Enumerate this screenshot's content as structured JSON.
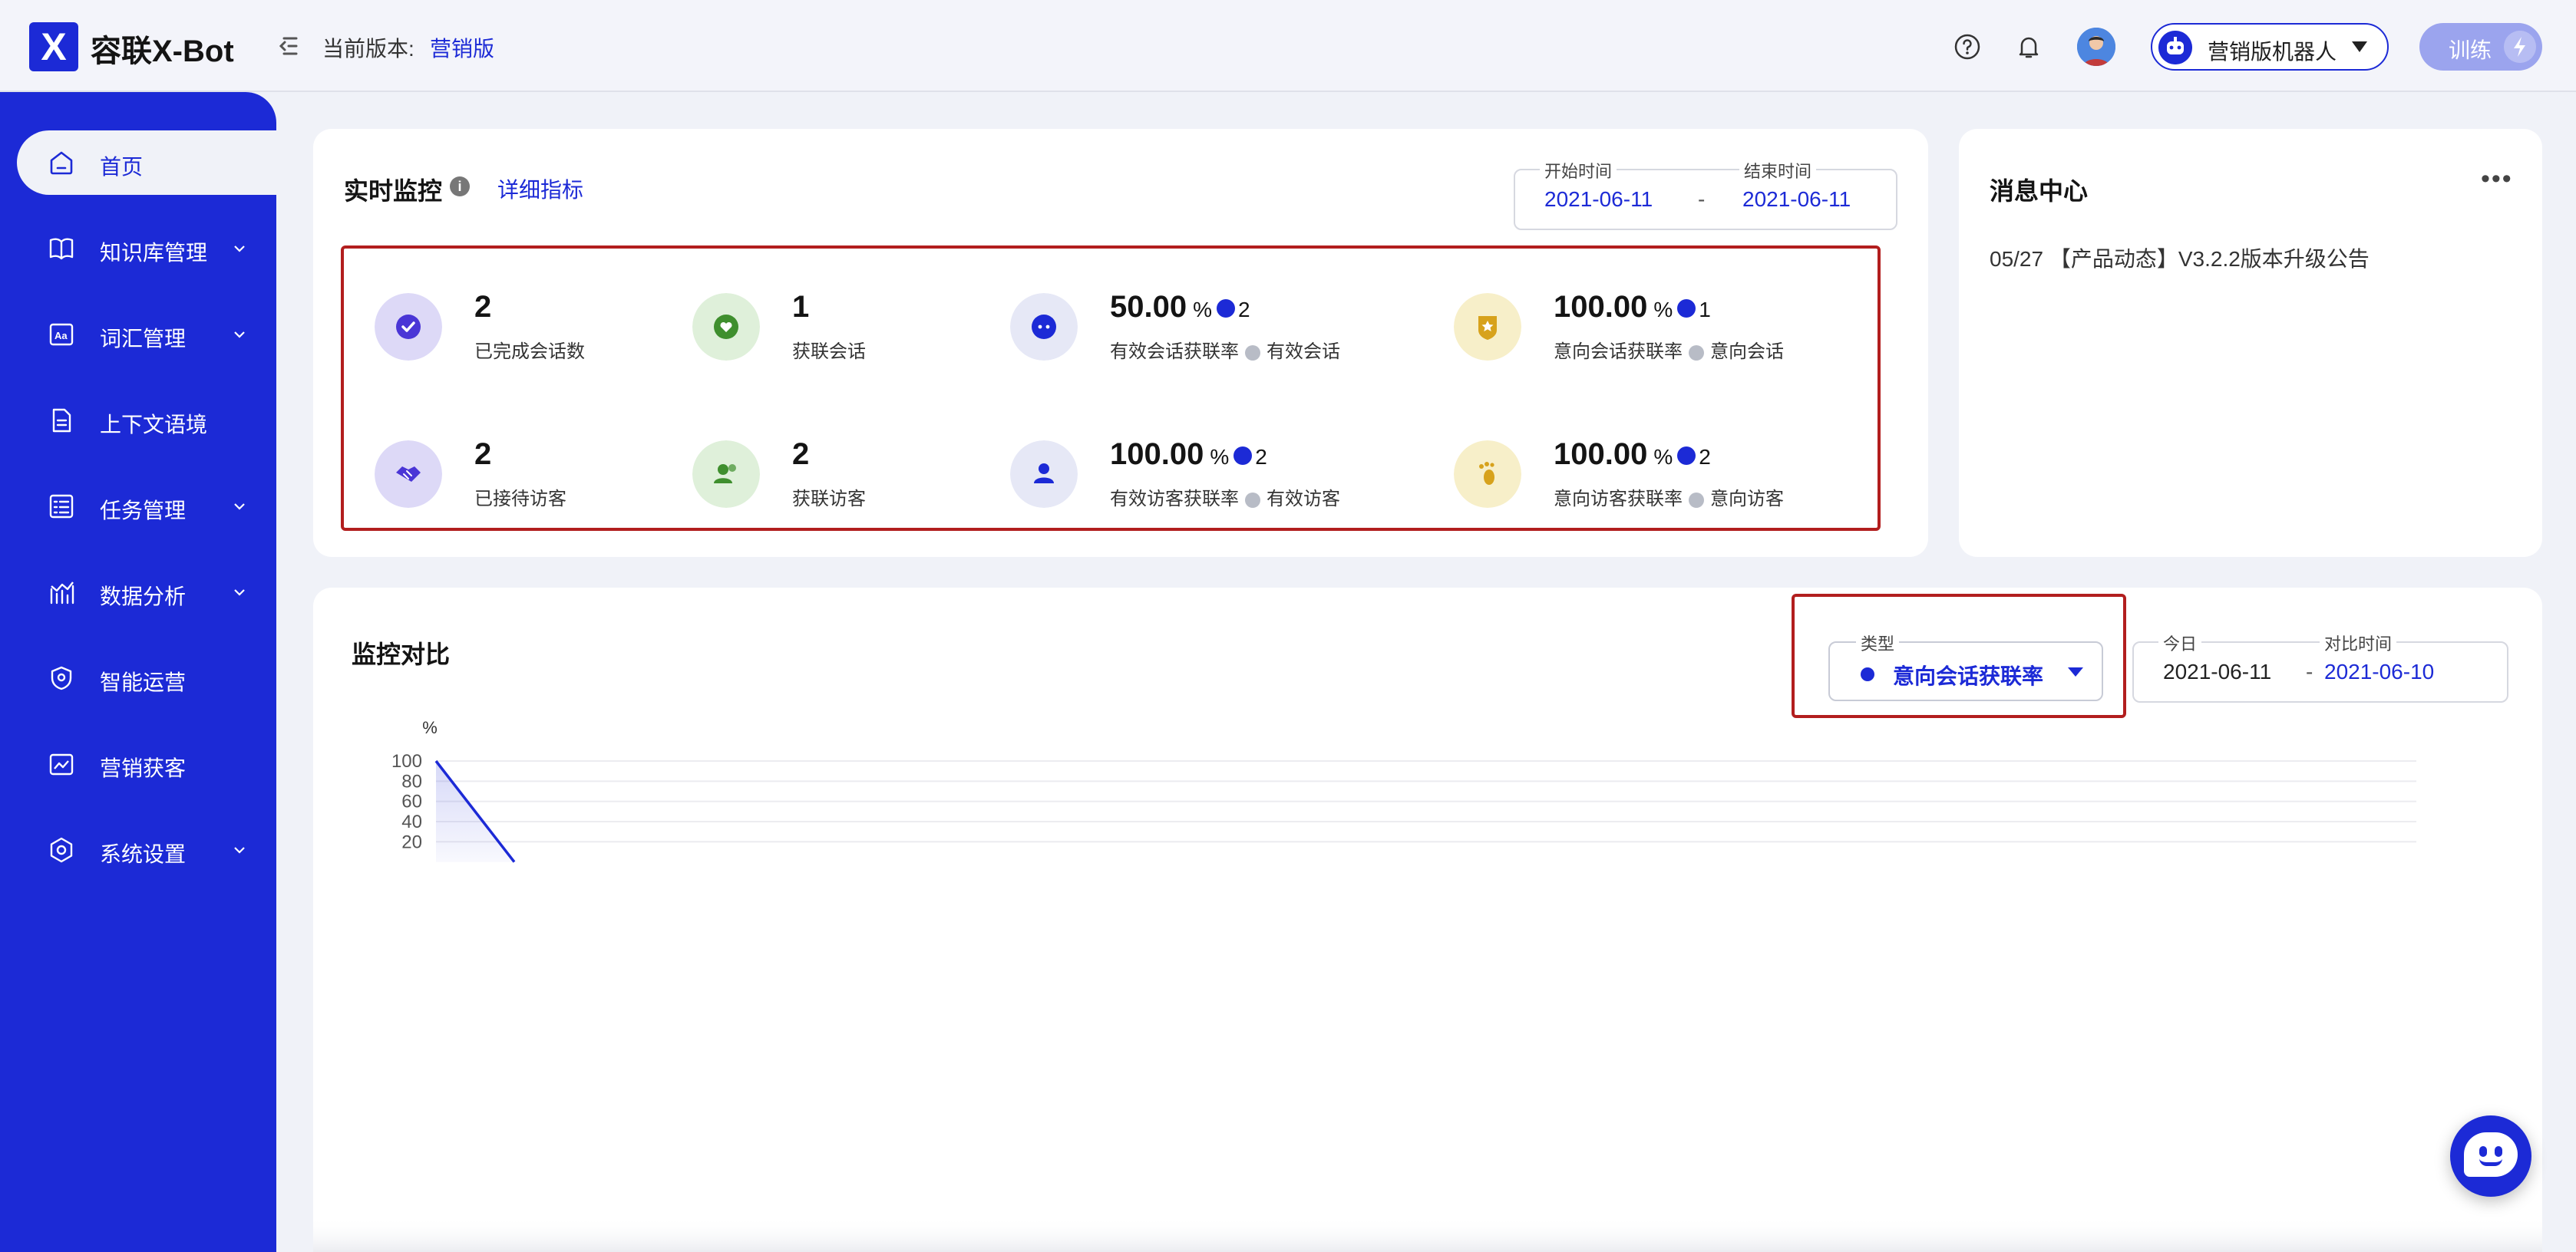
{
  "header": {
    "logo_letter": "X",
    "logo_text": "容联X-Bot",
    "version_label": "当前版本:",
    "version_value": "营销版",
    "robot_select_label": "营销版机器人",
    "train_button_label": "训练"
  },
  "sidebar": {
    "items": [
      {
        "label": "首页",
        "active": true,
        "expandable": false
      },
      {
        "label": "知识库管理",
        "active": false,
        "expandable": true
      },
      {
        "label": "词汇管理",
        "active": false,
        "expandable": true
      },
      {
        "label": "上下文语境",
        "active": false,
        "expandable": false
      },
      {
        "label": "任务管理",
        "active": false,
        "expandable": true
      },
      {
        "label": "数据分析",
        "active": false,
        "expandable": true
      },
      {
        "label": "智能运营",
        "active": false,
        "expandable": false
      },
      {
        "label": "营销获客",
        "active": false,
        "expandable": false
      },
      {
        "label": "系统设置",
        "active": false,
        "expandable": true
      }
    ]
  },
  "realtime": {
    "title": "实时监控",
    "info_glyph": "i",
    "detail_link": "详细指标",
    "start_label": "开始时间",
    "start_value": "2021-06-11",
    "end_label": "结束时间",
    "end_value": "2021-06-11",
    "separator": "-",
    "metrics": [
      {
        "value": "2",
        "label": "已完成会话数",
        "icon_color": "#ddd9f7",
        "icon_inner": "#4a36d6",
        "icon": "check-icon"
      },
      {
        "value": "1",
        "label": "获联会话",
        "icon_color": "#dff0da",
        "icon_inner": "#3f8f2e",
        "icon": "chat-heart-icon"
      },
      {
        "value": "50.00",
        "unit": "%",
        "count": "2",
        "label": "有效会话获联率",
        "sub_label": "有效会话",
        "icon_color": "#e6e8f6",
        "icon_inner": "#1c2ad6",
        "icon": "message-icon"
      },
      {
        "value": "100.00",
        "unit": "%",
        "count": "1",
        "label": "意向会话获联率",
        "sub_label": "意向会话",
        "icon_color": "#f7efc9",
        "icon_inner": "#d7a21c",
        "icon": "badge-icon"
      },
      {
        "value": "2",
        "label": "已接待访客",
        "icon_color": "#ddd9f7",
        "icon_inner": "#4a36d6",
        "icon": "handshake-icon"
      },
      {
        "value": "2",
        "label": "获联访客",
        "icon_color": "#dff0da",
        "icon_inner": "#3f8f2e",
        "icon": "users-icon"
      },
      {
        "value": "100.00",
        "unit": "%",
        "count": "2",
        "label": "有效访客获联率",
        "sub_label": "有效访客",
        "icon_color": "#e6e8f6",
        "icon_inner": "#1c2ad6",
        "icon": "user-icon"
      },
      {
        "value": "100.00",
        "unit": "%",
        "count": "2",
        "label": "意向访客获联率",
        "sub_label": "意向访客",
        "icon_color": "#f7efc9",
        "icon_inner": "#d7a21c",
        "icon": "footprint-icon"
      }
    ]
  },
  "messages": {
    "title": "消息中心",
    "more_glyph": "•••",
    "items": [
      {
        "text": "05/27 【产品动态】V3.2.2版本升级公告"
      }
    ]
  },
  "compare": {
    "title": "监控对比",
    "type_label": "类型",
    "type_value": "意向会话获联率",
    "today_label": "今日",
    "today_value": "2021-06-11",
    "compare_label": "对比时间",
    "compare_value": "2021-06-10",
    "separator": "-"
  },
  "chart_data": {
    "type": "area",
    "ylabel": "%",
    "ylim": [
      0,
      100
    ],
    "yticks": [
      20,
      40,
      60,
      80,
      100
    ],
    "grid": true,
    "series": [
      {
        "values": [
          100,
          0
        ],
        "color": "#1c2ad6"
      }
    ]
  },
  "colors": {
    "primary": "#1c2ad6",
    "highlight": "#b21e1e"
  }
}
